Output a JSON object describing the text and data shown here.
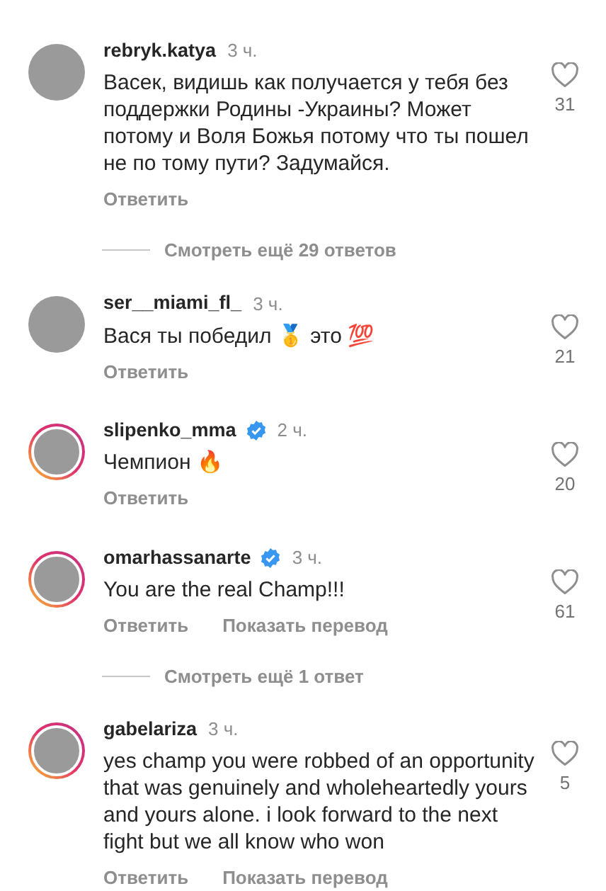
{
  "items": [
    {
      "kind": "comment",
      "username": "rebryk.katya",
      "verified": false,
      "story": false,
      "time": "3 ч.",
      "text": "Васек, видишь как получается у тебя без поддержки Родины -Украины? Может потому и Воля Божья потому что ты пошел не по тому пути? Задумайся.",
      "actions": [
        "Ответить"
      ],
      "likes": "31"
    },
    {
      "kind": "more",
      "label": "Смотреть ещё 29 ответов"
    },
    {
      "kind": "comment",
      "username": "ser__miami_fl_",
      "verified": false,
      "story": false,
      "time": "3 ч.",
      "text": "Вася ты победил 🥇 это 💯",
      "actions": [
        "Ответить"
      ],
      "likes": "21"
    },
    {
      "kind": "comment",
      "username": "slipenko_mma",
      "verified": true,
      "story": true,
      "time": "2 ч.",
      "text": "Чемпион 🔥",
      "actions": [
        "Ответить"
      ],
      "likes": "20"
    },
    {
      "kind": "comment",
      "username": "omarhassanarte",
      "verified": true,
      "story": true,
      "time": "3 ч.",
      "text": "You are the real Champ!!!",
      "actions": [
        "Ответить",
        "Показать перевод"
      ],
      "likes": "61"
    },
    {
      "kind": "more",
      "label": "Смотреть ещё 1 ответ"
    },
    {
      "kind": "comment",
      "username": "gabelariza",
      "verified": false,
      "story": true,
      "time": "3 ч.",
      "text": "yes champ you were robbed of an opportunity that was genuinely and wholeheartedly yours and yours alone. i look forward to the next fight but we all know who won",
      "actions": [
        "Ответить",
        "Показать перевод"
      ],
      "likes": "5"
    }
  ]
}
